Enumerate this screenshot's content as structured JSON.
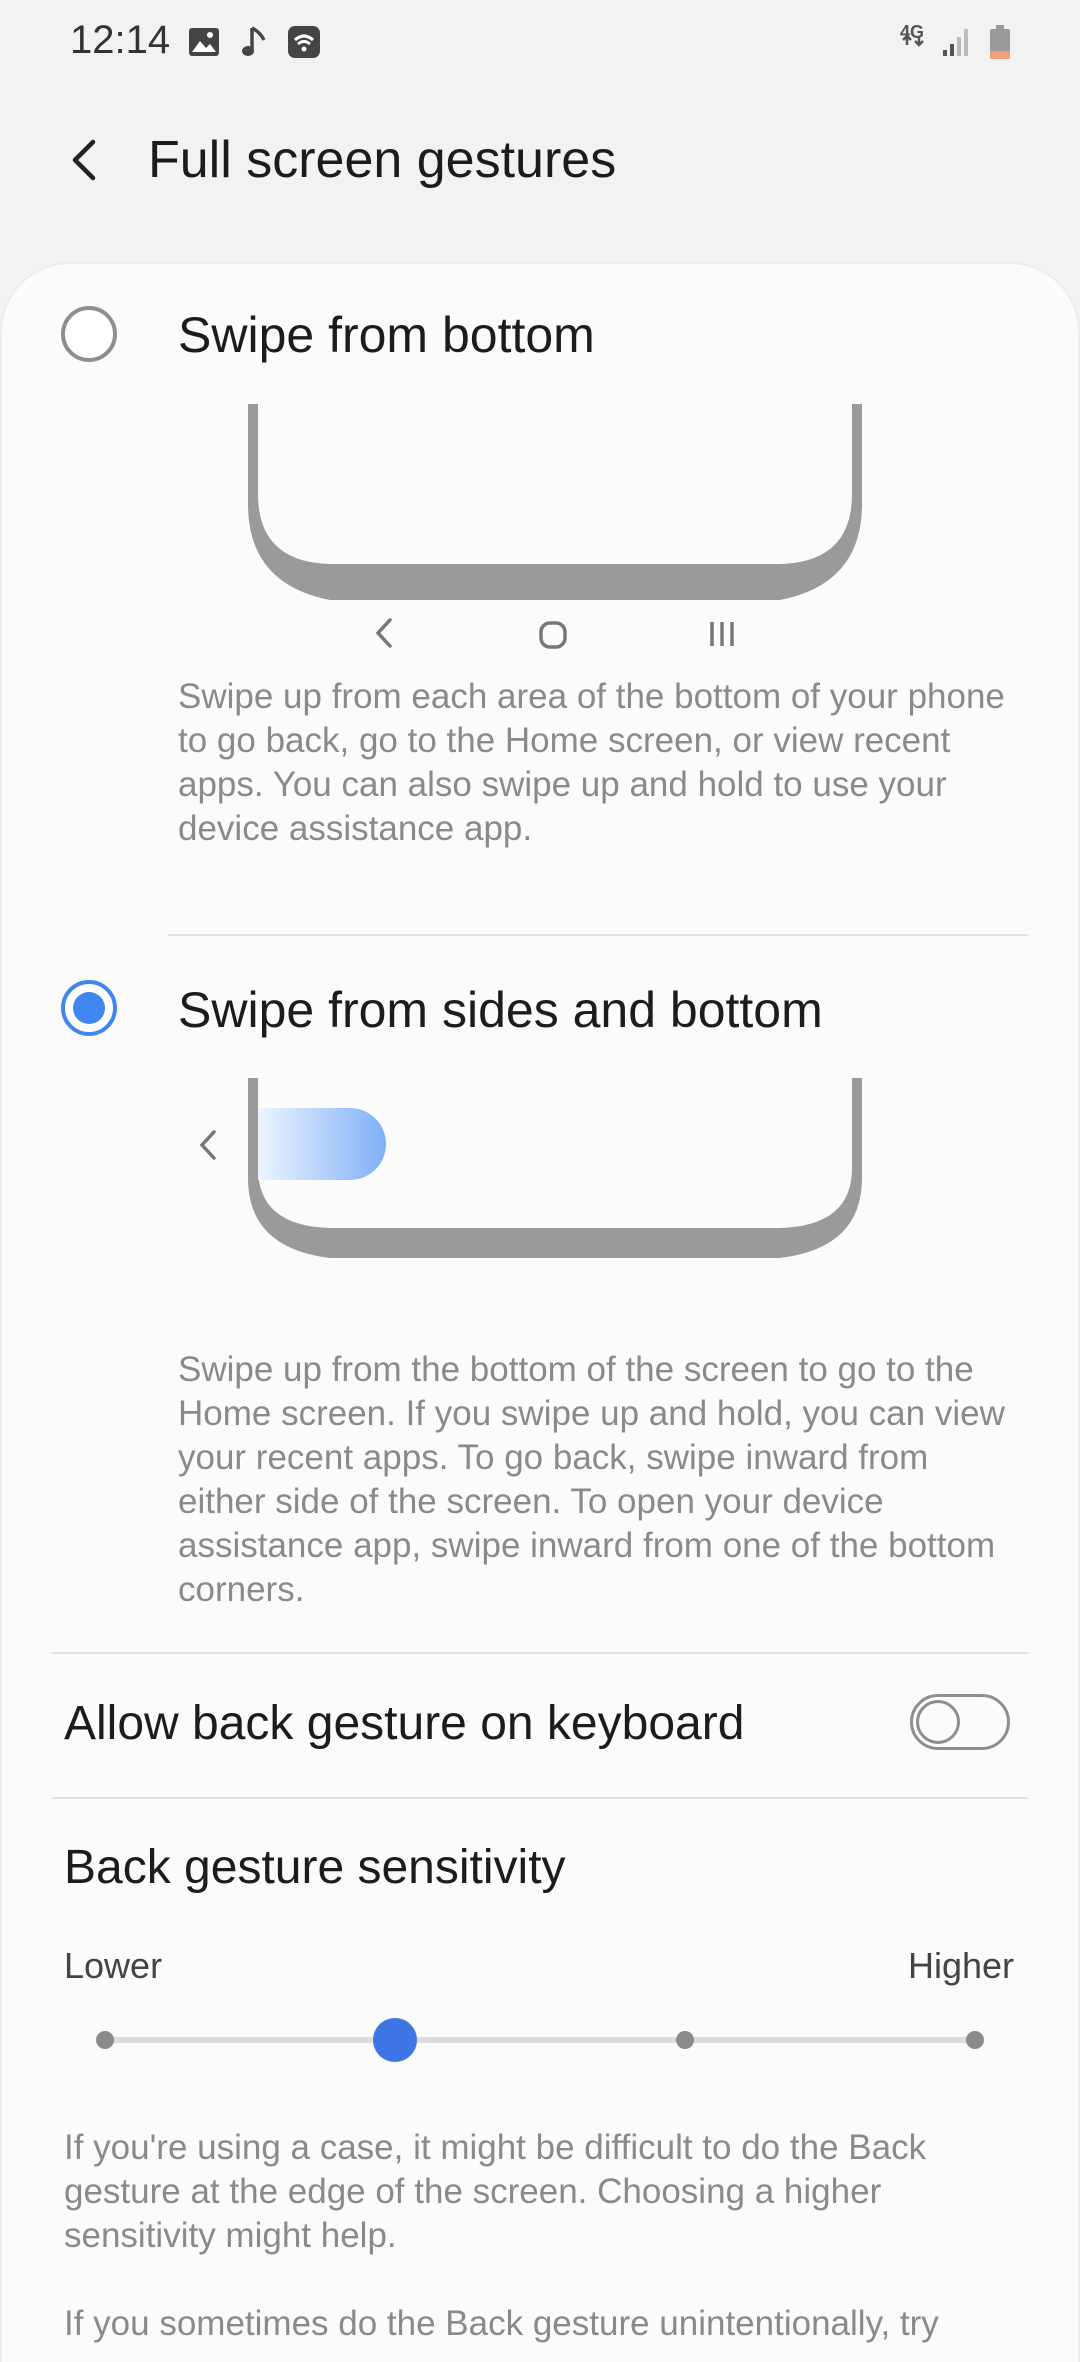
{
  "status_bar": {
    "time": "12:14",
    "icons": [
      "gallery-icon",
      "music-note-icon",
      "wifi-call-icon",
      "4g-icon",
      "signal-icon",
      "battery-icon"
    ],
    "network_label": "4G"
  },
  "header": {
    "title": "Full screen gestures"
  },
  "options": [
    {
      "title": "Swipe from bottom",
      "selected": false,
      "description": "Swipe up from each area of the bottom of your phone to go back, go to the Home screen, or view recent apps. You can also swipe up and hold to use your device assistance app."
    },
    {
      "title": "Swipe from sides and bottom",
      "selected": true,
      "description": "Swipe up from the bottom of the screen to go to the Home screen. If you swipe up and hold, you can view your recent apps. To go back, swipe inward from either side of the screen. To open your device assistance app, swipe inward from one of the bottom corners."
    }
  ],
  "settings": {
    "keyboard_toggle_label": "Allow back gesture on keyboard",
    "keyboard_toggle_on": false,
    "sensitivity_title": "Back gesture sensitivity",
    "sensitivity_low": "Lower",
    "sensitivity_high": "Higher",
    "sensitivity_level": 2,
    "sensitivity_steps": 4
  },
  "footnotes": [
    "If you're using a case, it might be difficult to do the Back gesture at the edge of the screen. Choosing a higher sensitivity might help.",
    "If you sometimes do the Back gesture unintentionally, try"
  ],
  "colors": {
    "accent": "#3f86ef",
    "slider_thumb": "#3f76e6",
    "illustration": "#9a9a9a"
  }
}
